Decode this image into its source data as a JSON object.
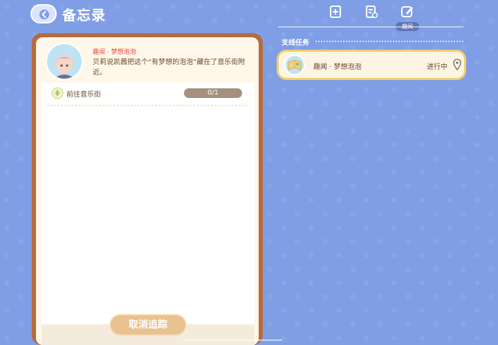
{
  "header": {
    "title": "备忘录",
    "back_icon": "chevron-left-icon"
  },
  "tabs": [
    {
      "icon": "add-book-icon",
      "active": false
    },
    {
      "icon": "document-settings-icon",
      "active": false
    },
    {
      "icon": "note-edit-icon",
      "active": true,
      "label": "趣闻"
    }
  ],
  "detail": {
    "quest_name": "趣闻 · 梦想泡泡",
    "description": "贝莉说凯茜把这个“有梦想的泡泡”藏在了音乐街附近。",
    "goals": [
      {
        "label": "前往音乐街",
        "progress": "0/1"
      }
    ],
    "cancel_label": "取消追踪"
  },
  "sidebar": {
    "section_label": "支线任务",
    "quests": [
      {
        "name": "趣闻 · 梦想泡泡",
        "status": "进行中"
      }
    ]
  },
  "colors": {
    "background": "#7f9ee6",
    "panel_border": "#b96a3b",
    "quest_name_red": "#e0493b",
    "card_border": "#f2cf6b",
    "button": "#e8c28f"
  }
}
